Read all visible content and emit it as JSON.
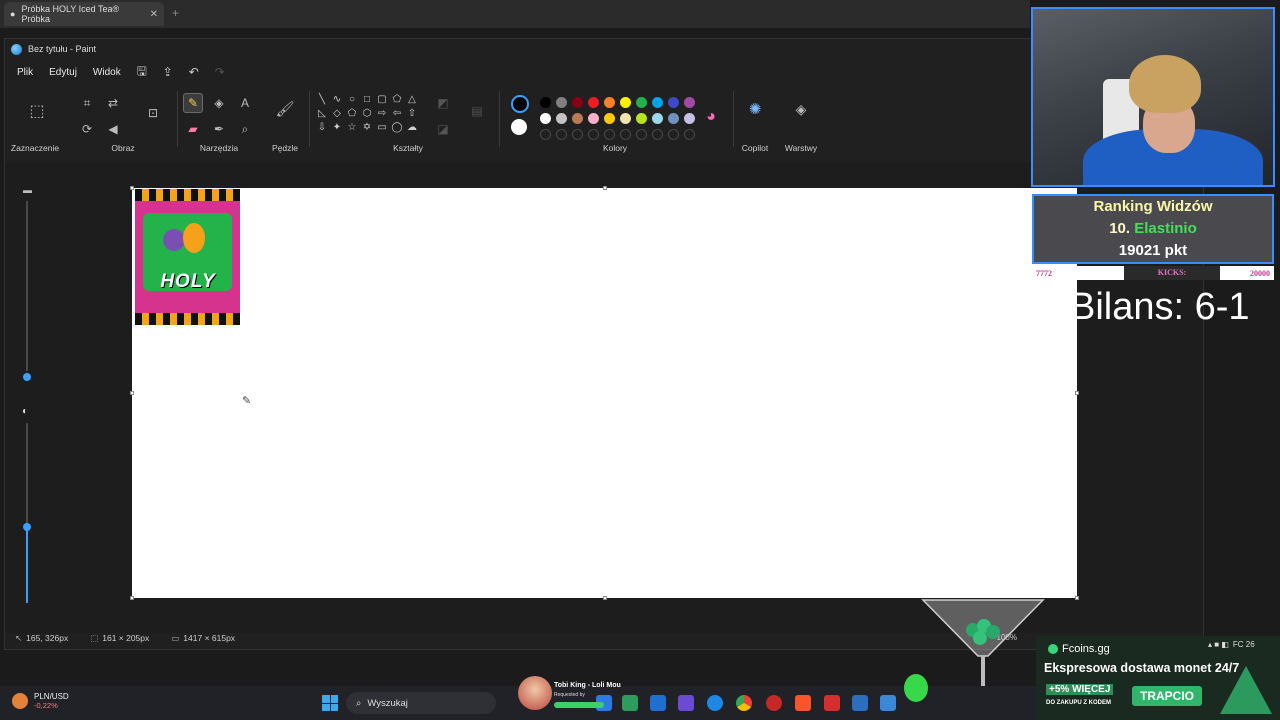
{
  "browser": {
    "tab_title": "Próbka HOLY Iced Tea® Próbka",
    "close": "✕",
    "new_tab": "+"
  },
  "paint": {
    "title": "Bez tytułu - Paint",
    "menu": [
      "Plik",
      "Edytuj",
      "Widok"
    ],
    "groups": {
      "selection": "Zaznaczenie",
      "image": "Obraz",
      "tools": "Narzędzia",
      "brushes": "Pędzle",
      "shapes": "Kształty",
      "colors": "Kolory",
      "copilot": "Copilot",
      "layers": "Warstwy"
    },
    "palette": [
      "#000000",
      "#7f7f7f",
      "#880015",
      "#ed1c24",
      "#ff7f27",
      "#fff200",
      "#22b14c",
      "#00a2e8",
      "#3f48cc",
      "#a349a4",
      "#ffffff",
      "#c3c3c3",
      "#b97a57",
      "#ffaec9",
      "#ffc90e",
      "#efe4b0",
      "#b5e61d",
      "#99d9ea",
      "#7092be",
      "#c8bfe7"
    ],
    "status": {
      "cursor": "165, 326px",
      "selection": "161 × 205px",
      "canvas_size": "1417 × 615px",
      "zoom": "100%"
    },
    "image_text": "HOLY"
  },
  "overlay": {
    "ranking_title": "Ranking Widzów",
    "ranking_pos": "10.",
    "ranking_name": "Elastinio",
    "ranking_points": "19021 pkt",
    "kicks_left": "7772",
    "kicks_label": "KICKS:",
    "kicks_right": "20000",
    "bilans": "Bilans: 6-1"
  },
  "fcoins": {
    "brand": "Fcoins.gg",
    "headline": "Ekspresowa dostawa monet 24/7",
    "promo_pct": "+5% WIĘCEJ",
    "promo_sub": "DO ZAKUPU Z KODEM",
    "code": "TRAPCIO"
  },
  "taskbar": {
    "ticker": "PLN/USD",
    "change": "-0,22%",
    "search": "Wyszukaj",
    "media_title": "Tobi King - Loli Mou",
    "media_sub": "Requested by",
    "tray": "FC 26"
  }
}
